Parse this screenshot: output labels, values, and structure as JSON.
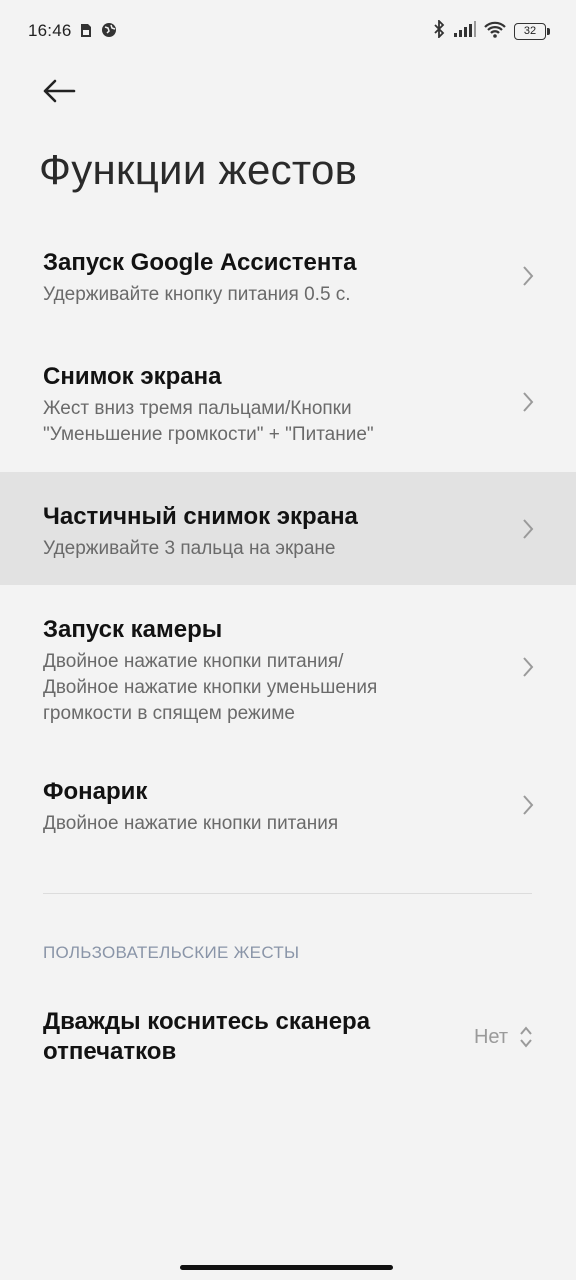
{
  "status_bar": {
    "time": "16:46",
    "battery_level": "32",
    "icons": [
      "sim-icon",
      "globe-icon",
      "bluetooth-icon",
      "signal-icon",
      "wifi-icon",
      "battery-icon"
    ]
  },
  "header": {
    "title": "Функции жестов",
    "back_icon": "arrow-left-icon"
  },
  "gesture_items": [
    {
      "title": "Запуск Google Ассистента",
      "subtitle": "Удерживайте кнопку питания 0.5 с."
    },
    {
      "title": "Снимок экрана",
      "subtitle_lines": [
        "Жест вниз тремя пальцами/Кнопки",
        "\"Уменьшение громкости\" + \"Питание\""
      ]
    },
    {
      "title": "Частичный снимок экрана",
      "subtitle": "Удерживайте 3 пальца на экране",
      "highlighted": true
    },
    {
      "title": "Запуск камеры",
      "subtitle_lines": [
        "Двойное нажатие кнопки питания/",
        "Двойное нажатие кнопки уменьшения",
        "громкости в спящем режиме"
      ]
    },
    {
      "title": "Фонарик",
      "subtitle": "Двойное нажатие кнопки питания"
    }
  ],
  "custom_gestures": {
    "section_title": "ПОЛЬЗОВАТЕЛЬСКИЕ ЖЕСТЫ",
    "fingerprint_title_lines": [
      "Дважды коснитесь сканера",
      "отпечатков"
    ],
    "fingerprint_value": "Нет"
  },
  "colors": {
    "background": "#f3f3f3",
    "highlight": "#e2e2e2",
    "section_header": "#8a95a8"
  }
}
